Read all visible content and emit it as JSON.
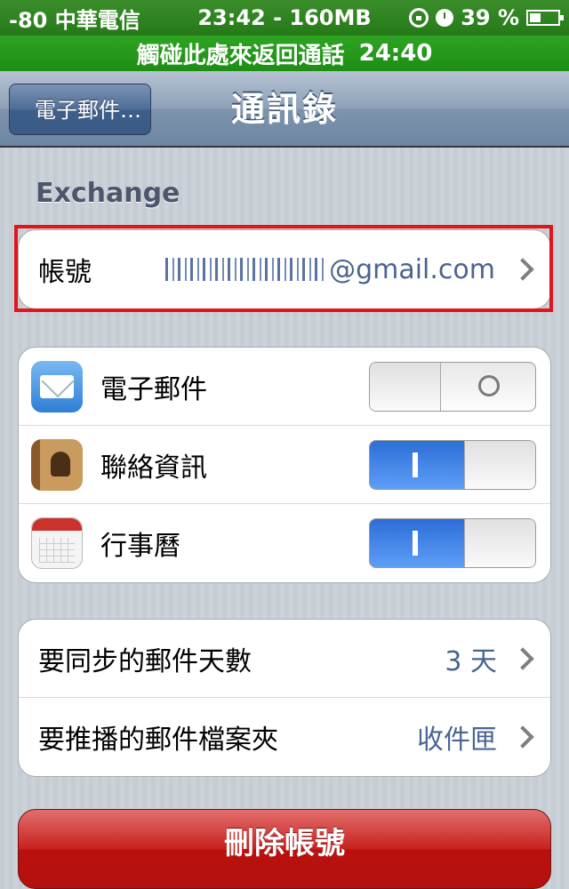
{
  "status_bar": {
    "carrier": "-80 中華電信",
    "center": "23:42 - 160MB",
    "battery": "39 %",
    "battery_level": 0.39,
    "icons": [
      "orientation-lock-icon",
      "clock-icon",
      "battery-icon"
    ]
  },
  "call_bar": {
    "label": "觸碰此處來返回通話",
    "time": "24:40"
  },
  "nav": {
    "back_label": "電子郵件…",
    "title": "通訊錄"
  },
  "section_header": "Exchange",
  "account": {
    "label": "帳號",
    "value": "@gmail.com"
  },
  "toggles": [
    {
      "label": "電子郵件",
      "icon": "mail-icon",
      "state": "off"
    },
    {
      "label": "聯絡資訊",
      "icon": "contacts-icon",
      "state": "on"
    },
    {
      "label": "行事曆",
      "icon": "calendar-icon",
      "state": "on"
    }
  ],
  "settings": [
    {
      "label": "要同步的郵件天數",
      "value": "3 天"
    },
    {
      "label": "要推播的郵件檔案夾",
      "value": "收件匣"
    }
  ],
  "delete_button": "刪除帳號",
  "colors": {
    "status_bar": "#257a18",
    "call_bar": "#2fa423",
    "nav_bar": "#7e93ad",
    "value_text": "#4a6592",
    "toggle_on": "#2d6ed6",
    "delete": "#c7221f",
    "highlight": "#e0161b"
  }
}
